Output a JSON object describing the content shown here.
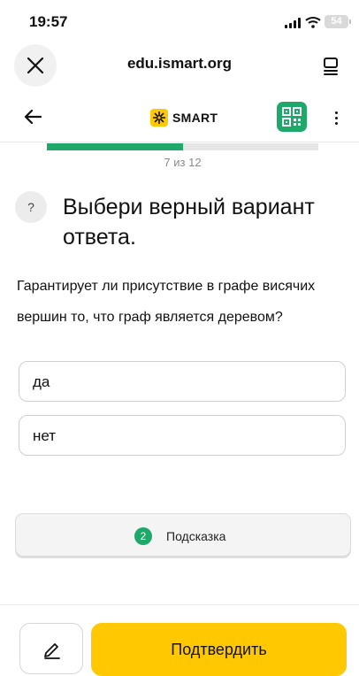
{
  "status_bar": {
    "time": "19:57",
    "battery": "54"
  },
  "browser": {
    "url": "edu.ismart.org"
  },
  "app_header": {
    "logo_text": "SMART"
  },
  "progress": {
    "current": 7,
    "total": 12,
    "label": "7 из 12",
    "fraction": 0.5
  },
  "question": {
    "help_glyph": "?",
    "title": "Выбери верный вариант ответа.",
    "text": "Гарантирует ли присутствие в графе висячих вершин то, что граф является деревом?"
  },
  "options": [
    {
      "label": "да"
    },
    {
      "label": "нет"
    }
  ],
  "hint": {
    "count": "2",
    "label": "Подсказка"
  },
  "bottom": {
    "confirm_label": "Подтвердить"
  },
  "colors": {
    "accent_green": "#1ea86a",
    "accent_yellow": "#ffc800"
  },
  "icons": [
    "close-icon",
    "tabs-icon",
    "back-arrow-icon",
    "qr-code-icon",
    "more-vertical-icon",
    "pencil-icon",
    "signal-icon",
    "wifi-icon",
    "battery-icon"
  ]
}
